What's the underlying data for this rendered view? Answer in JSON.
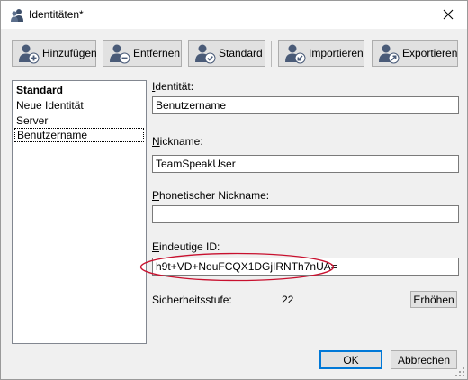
{
  "window": {
    "title": "Identitäten*",
    "title_icon": "users-icon",
    "close_icon": "close-icon"
  },
  "toolbar": {
    "add": {
      "label": "Hinzufügen",
      "icon": "user-add-icon"
    },
    "remove": {
      "label": "Entfernen",
      "icon": "user-remove-icon"
    },
    "default": {
      "label": "Standard",
      "icon": "user-check-icon"
    },
    "import": {
      "label": "Importieren",
      "icon": "user-import-icon"
    },
    "export": {
      "label": "Exportieren",
      "icon": "user-export-icon"
    }
  },
  "identities": {
    "items": [
      {
        "label": "Standard",
        "bold": true,
        "selected": false
      },
      {
        "label": "Neue Identität",
        "bold": false,
        "selected": false
      },
      {
        "label": "Server",
        "bold": false,
        "selected": false
      },
      {
        "label": "Benutzername",
        "bold": false,
        "selected": true
      }
    ]
  },
  "form": {
    "identity": {
      "label_accel": "I",
      "label_rest": "dentität:",
      "value": "Benutzername"
    },
    "nickname": {
      "label_accel": "N",
      "label_rest": "ickname:",
      "value": "TeamSpeakUser"
    },
    "phonetic": {
      "label_accel": "P",
      "label_rest": "honetischer Nickname:",
      "value": ""
    },
    "unique_id": {
      "label_accel": "E",
      "label_rest": "indeutige ID:",
      "value": "h9t+VD+NouFCQX1DGjIRNTh7nUA="
    },
    "security": {
      "label": "Sicherheitsstufe:",
      "value": "22",
      "raise_label": "Erhöhen"
    }
  },
  "footer": {
    "ok_label": "OK",
    "cancel_label": "Abbrechen"
  },
  "colors": {
    "highlight_ellipse": "#c8102e",
    "focus_border": "#0078d7",
    "button_face": "#e1e1e1"
  }
}
